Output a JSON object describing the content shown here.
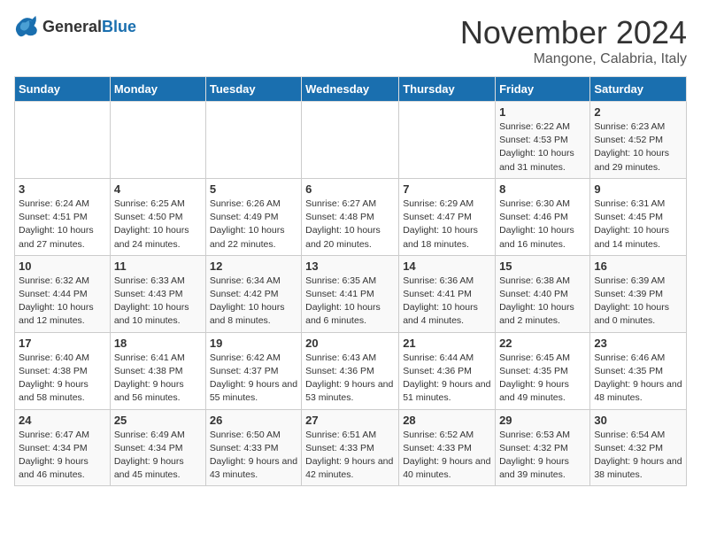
{
  "logo": {
    "text_general": "General",
    "text_blue": "Blue"
  },
  "header": {
    "month_title": "November 2024",
    "subtitle": "Mangone, Calabria, Italy"
  },
  "days_of_week": [
    "Sunday",
    "Monday",
    "Tuesday",
    "Wednesday",
    "Thursday",
    "Friday",
    "Saturday"
  ],
  "weeks": [
    [
      {
        "day": "",
        "info": ""
      },
      {
        "day": "",
        "info": ""
      },
      {
        "day": "",
        "info": ""
      },
      {
        "day": "",
        "info": ""
      },
      {
        "day": "",
        "info": ""
      },
      {
        "day": "1",
        "info": "Sunrise: 6:22 AM\nSunset: 4:53 PM\nDaylight: 10 hours and 31 minutes."
      },
      {
        "day": "2",
        "info": "Sunrise: 6:23 AM\nSunset: 4:52 PM\nDaylight: 10 hours and 29 minutes."
      }
    ],
    [
      {
        "day": "3",
        "info": "Sunrise: 6:24 AM\nSunset: 4:51 PM\nDaylight: 10 hours and 27 minutes."
      },
      {
        "day": "4",
        "info": "Sunrise: 6:25 AM\nSunset: 4:50 PM\nDaylight: 10 hours and 24 minutes."
      },
      {
        "day": "5",
        "info": "Sunrise: 6:26 AM\nSunset: 4:49 PM\nDaylight: 10 hours and 22 minutes."
      },
      {
        "day": "6",
        "info": "Sunrise: 6:27 AM\nSunset: 4:48 PM\nDaylight: 10 hours and 20 minutes."
      },
      {
        "day": "7",
        "info": "Sunrise: 6:29 AM\nSunset: 4:47 PM\nDaylight: 10 hours and 18 minutes."
      },
      {
        "day": "8",
        "info": "Sunrise: 6:30 AM\nSunset: 4:46 PM\nDaylight: 10 hours and 16 minutes."
      },
      {
        "day": "9",
        "info": "Sunrise: 6:31 AM\nSunset: 4:45 PM\nDaylight: 10 hours and 14 minutes."
      }
    ],
    [
      {
        "day": "10",
        "info": "Sunrise: 6:32 AM\nSunset: 4:44 PM\nDaylight: 10 hours and 12 minutes."
      },
      {
        "day": "11",
        "info": "Sunrise: 6:33 AM\nSunset: 4:43 PM\nDaylight: 10 hours and 10 minutes."
      },
      {
        "day": "12",
        "info": "Sunrise: 6:34 AM\nSunset: 4:42 PM\nDaylight: 10 hours and 8 minutes."
      },
      {
        "day": "13",
        "info": "Sunrise: 6:35 AM\nSunset: 4:41 PM\nDaylight: 10 hours and 6 minutes."
      },
      {
        "day": "14",
        "info": "Sunrise: 6:36 AM\nSunset: 4:41 PM\nDaylight: 10 hours and 4 minutes."
      },
      {
        "day": "15",
        "info": "Sunrise: 6:38 AM\nSunset: 4:40 PM\nDaylight: 10 hours and 2 minutes."
      },
      {
        "day": "16",
        "info": "Sunrise: 6:39 AM\nSunset: 4:39 PM\nDaylight: 10 hours and 0 minutes."
      }
    ],
    [
      {
        "day": "17",
        "info": "Sunrise: 6:40 AM\nSunset: 4:38 PM\nDaylight: 9 hours and 58 minutes."
      },
      {
        "day": "18",
        "info": "Sunrise: 6:41 AM\nSunset: 4:38 PM\nDaylight: 9 hours and 56 minutes."
      },
      {
        "day": "19",
        "info": "Sunrise: 6:42 AM\nSunset: 4:37 PM\nDaylight: 9 hours and 55 minutes."
      },
      {
        "day": "20",
        "info": "Sunrise: 6:43 AM\nSunset: 4:36 PM\nDaylight: 9 hours and 53 minutes."
      },
      {
        "day": "21",
        "info": "Sunrise: 6:44 AM\nSunset: 4:36 PM\nDaylight: 9 hours and 51 minutes."
      },
      {
        "day": "22",
        "info": "Sunrise: 6:45 AM\nSunset: 4:35 PM\nDaylight: 9 hours and 49 minutes."
      },
      {
        "day": "23",
        "info": "Sunrise: 6:46 AM\nSunset: 4:35 PM\nDaylight: 9 hours and 48 minutes."
      }
    ],
    [
      {
        "day": "24",
        "info": "Sunrise: 6:47 AM\nSunset: 4:34 PM\nDaylight: 9 hours and 46 minutes."
      },
      {
        "day": "25",
        "info": "Sunrise: 6:49 AM\nSunset: 4:34 PM\nDaylight: 9 hours and 45 minutes."
      },
      {
        "day": "26",
        "info": "Sunrise: 6:50 AM\nSunset: 4:33 PM\nDaylight: 9 hours and 43 minutes."
      },
      {
        "day": "27",
        "info": "Sunrise: 6:51 AM\nSunset: 4:33 PM\nDaylight: 9 hours and 42 minutes."
      },
      {
        "day": "28",
        "info": "Sunrise: 6:52 AM\nSunset: 4:33 PM\nDaylight: 9 hours and 40 minutes."
      },
      {
        "day": "29",
        "info": "Sunrise: 6:53 AM\nSunset: 4:32 PM\nDaylight: 9 hours and 39 minutes."
      },
      {
        "day": "30",
        "info": "Sunrise: 6:54 AM\nSunset: 4:32 PM\nDaylight: 9 hours and 38 minutes."
      }
    ]
  ]
}
